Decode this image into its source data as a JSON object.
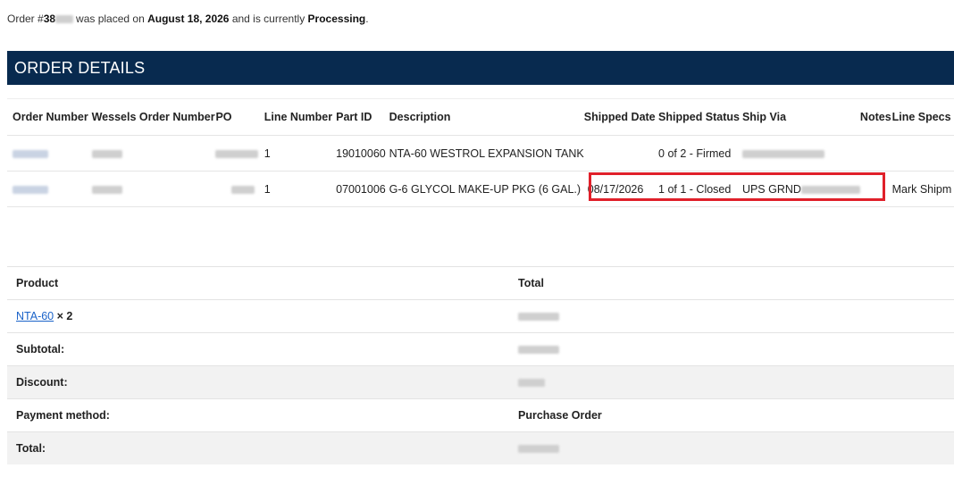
{
  "order_summary": {
    "prefix": "Order #",
    "order_number_visible": "38",
    "middle": "was placed on",
    "date": "August 18, 2026",
    "status_prefix": "and is currently",
    "status": "Processing",
    "period": "."
  },
  "section": {
    "title": "ORDER DETAILS"
  },
  "details_table": {
    "headers": [
      "Order Number",
      "Wessels Order Number",
      "PO",
      "Line Number",
      "Part ID",
      "Description",
      "Shipped Date",
      "Shipped Status",
      "Ship Via",
      "Notes",
      "Line Specs"
    ],
    "rows": [
      {
        "line_number": "1",
        "part_id": "19010060",
        "description": "NTA-60 WESTROL EXPANSION TANK",
        "shipped_date": "",
        "shipped_status": "0 of 2 - Firmed",
        "ship_via": "",
        "notes": "",
        "line_specs": ""
      },
      {
        "line_number": "1",
        "part_id": "07001006",
        "description": "G-6 GLYCOL MAKE-UP PKG (6 GAL.)",
        "shipped_date": "08/17/2026",
        "shipped_status": "1 of 1 - Closed",
        "ship_via": "UPS GRND",
        "notes": "",
        "line_specs": "Mark Shipm"
      }
    ]
  },
  "totals_table": {
    "product_header": "Product",
    "total_header": "Total",
    "product_name": "NTA-60",
    "product_qty": "× 2",
    "subtotal_label": "Subtotal:",
    "discount_label": "Discount:",
    "payment_label": "Payment method:",
    "payment_value": "Purchase Order",
    "total_label": "Total:"
  },
  "colors": {
    "header_bar": "#082a4f",
    "highlight": "#e0202a",
    "link": "#1b63c9"
  }
}
